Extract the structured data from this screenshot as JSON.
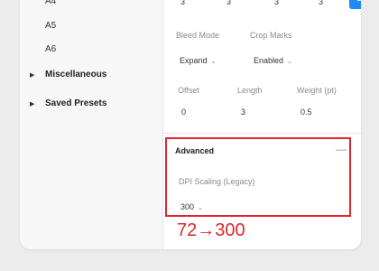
{
  "sidebar": {
    "items": [
      {
        "label": "A4"
      },
      {
        "label": "A5"
      },
      {
        "label": "A6"
      }
    ],
    "groups": [
      {
        "label": "Miscellaneous",
        "icon": "caret-right-icon"
      },
      {
        "label": "Saved Presets",
        "icon": "caret-right-icon"
      }
    ]
  },
  "margins_row": {
    "values": [
      "3",
      "3",
      "3",
      "3"
    ],
    "link_icon": "link-icon",
    "accent": "#1d8cf8"
  },
  "bleed": {
    "label": "Bleed Mode",
    "value": "Expand"
  },
  "crop": {
    "label": "Crop Marks",
    "value": "Enabled"
  },
  "offset": {
    "label": "Offset",
    "value": "0"
  },
  "length": {
    "label": "Length",
    "value": "3"
  },
  "weight": {
    "label": "Weight (pt)",
    "value": "0.5"
  },
  "advanced": {
    "title": "Advanced",
    "collapse_symbol": "—",
    "dpi_label": "DPI Scaling (Legacy)",
    "dpi_value": "300"
  },
  "annotation": {
    "text": "72→300",
    "color": "#e0262d"
  }
}
